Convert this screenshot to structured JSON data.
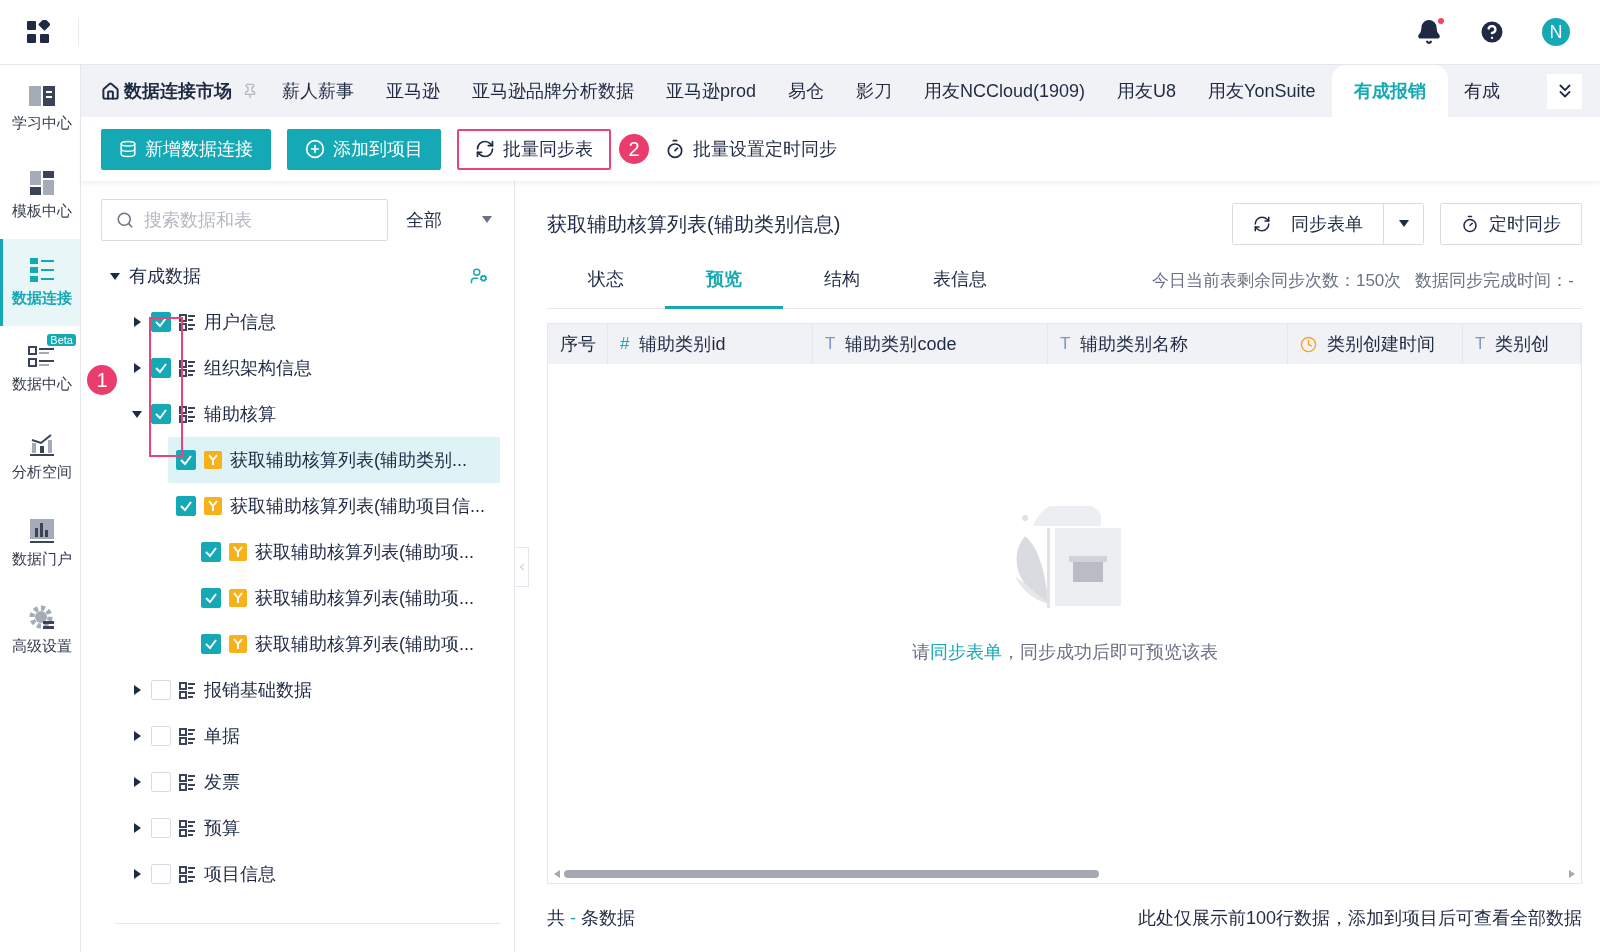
{
  "header": {
    "avatar": "N",
    "notification_dot": true
  },
  "nav": [
    {
      "label": "学习中心",
      "selected": false
    },
    {
      "label": "模板中心",
      "selected": false
    },
    {
      "label": "数据连接",
      "selected": true
    },
    {
      "label": "数据中心",
      "selected": false,
      "badge": "Beta"
    },
    {
      "label": "分析空间",
      "selected": false
    },
    {
      "label": "数据门户",
      "selected": false
    },
    {
      "label": "高级设置",
      "selected": false
    }
  ],
  "market_tab": "数据连接市场",
  "source_tabs": [
    {
      "label": "薪人薪事",
      "selected": false
    },
    {
      "label": "亚马逊",
      "selected": false
    },
    {
      "label": "亚马逊品牌分析数据",
      "selected": false
    },
    {
      "label": "亚马逊prod",
      "selected": false
    },
    {
      "label": "易仓",
      "selected": false
    },
    {
      "label": "影刀",
      "selected": false
    },
    {
      "label": "用友NCCloud(1909)",
      "selected": false
    },
    {
      "label": "用友U8",
      "selected": false
    },
    {
      "label": "用友YonSuite",
      "selected": false
    },
    {
      "label": "有成报销",
      "selected": true
    },
    {
      "label": "有成",
      "selected": false
    }
  ],
  "toolbar": [
    {
      "kind": "primary",
      "label": "新增数据连接",
      "highlighted": false
    },
    {
      "kind": "primary",
      "label": "添加到项目",
      "highlighted": false
    },
    {
      "kind": "plain",
      "label": "批量同步表",
      "highlighted": true
    },
    {
      "kind": "plain",
      "label": "批量设置定时同步",
      "highlighted": false,
      "marker": "2"
    }
  ],
  "search": {
    "placeholder": "搜索数据和表"
  },
  "filter": {
    "value": "全部"
  },
  "tree": {
    "label": "有成数据",
    "expanded": true,
    "marker": "1",
    "children": [
      {
        "label": "用户信息",
        "kind": "folder",
        "checked": true,
        "expanded": false,
        "selected": false
      },
      {
        "label": "组织架构信息",
        "kind": "folder",
        "checked": true,
        "expanded": false,
        "selected": false
      },
      {
        "label": "辅助核算",
        "kind": "folder",
        "checked": true,
        "expanded": true,
        "selected": false,
        "children": [
          {
            "label": "获取辅助核算列表(辅助类别...",
            "kind": "table",
            "checked": true,
            "selected": true
          },
          {
            "label": "获取辅助核算列表(辅助项目信...",
            "kind": "table",
            "checked": true,
            "selected": false,
            "children": [
              {
                "label": "获取辅助核算列表(辅助项...",
                "kind": "table",
                "checked": true,
                "selected": false
              },
              {
                "label": "获取辅助核算列表(辅助项...",
                "kind": "table",
                "checked": true,
                "selected": false
              },
              {
                "label": "获取辅助核算列表(辅助项...",
                "kind": "table",
                "checked": true,
                "selected": false
              }
            ]
          }
        ]
      },
      {
        "label": "报销基础数据",
        "kind": "folder",
        "checked": false,
        "expanded": false,
        "selected": false
      },
      {
        "label": "单据",
        "kind": "folder",
        "checked": false,
        "expanded": false,
        "selected": false
      },
      {
        "label": "发票",
        "kind": "folder",
        "checked": false,
        "expanded": false,
        "selected": false
      },
      {
        "label": "预算",
        "kind": "folder",
        "checked": false,
        "expanded": false,
        "selected": false
      },
      {
        "label": "项目信息",
        "kind": "folder",
        "checked": false,
        "expanded": false,
        "selected": false
      }
    ]
  },
  "detail": {
    "title": "获取辅助核算列表(辅助类别信息)",
    "sync_button": "同步表单",
    "schedule_button": "定时同步",
    "tabs": [
      {
        "label": "状态",
        "selected": false
      },
      {
        "label": "预览",
        "selected": true
      },
      {
        "label": "结构",
        "selected": false
      },
      {
        "label": "表信息",
        "selected": false
      }
    ],
    "sync_info": "今日当前表剩余同步次数：150次",
    "finish_info": "数据同步完成时间：-",
    "columns": [
      {
        "label": "序号",
        "kind": "plain"
      },
      {
        "label": "辅助类别id",
        "kind": "number",
        "mark": "#"
      },
      {
        "label": "辅助类别code",
        "kind": "text",
        "mark": "T"
      },
      {
        "label": "辅助类别名称",
        "kind": "text",
        "mark": "T"
      },
      {
        "label": "类别创建时间",
        "kind": "time"
      },
      {
        "label": "类别创",
        "kind": "text",
        "mark": "T"
      }
    ],
    "empty": {
      "before": "请",
      "link": "同步表单",
      "after": "，同步成功后即可预览该表"
    },
    "total": {
      "before": "共",
      "count": "-",
      "after": "条数据"
    },
    "note": "此处仅展示前100行数据，添加到项目后可查看全部数据"
  }
}
